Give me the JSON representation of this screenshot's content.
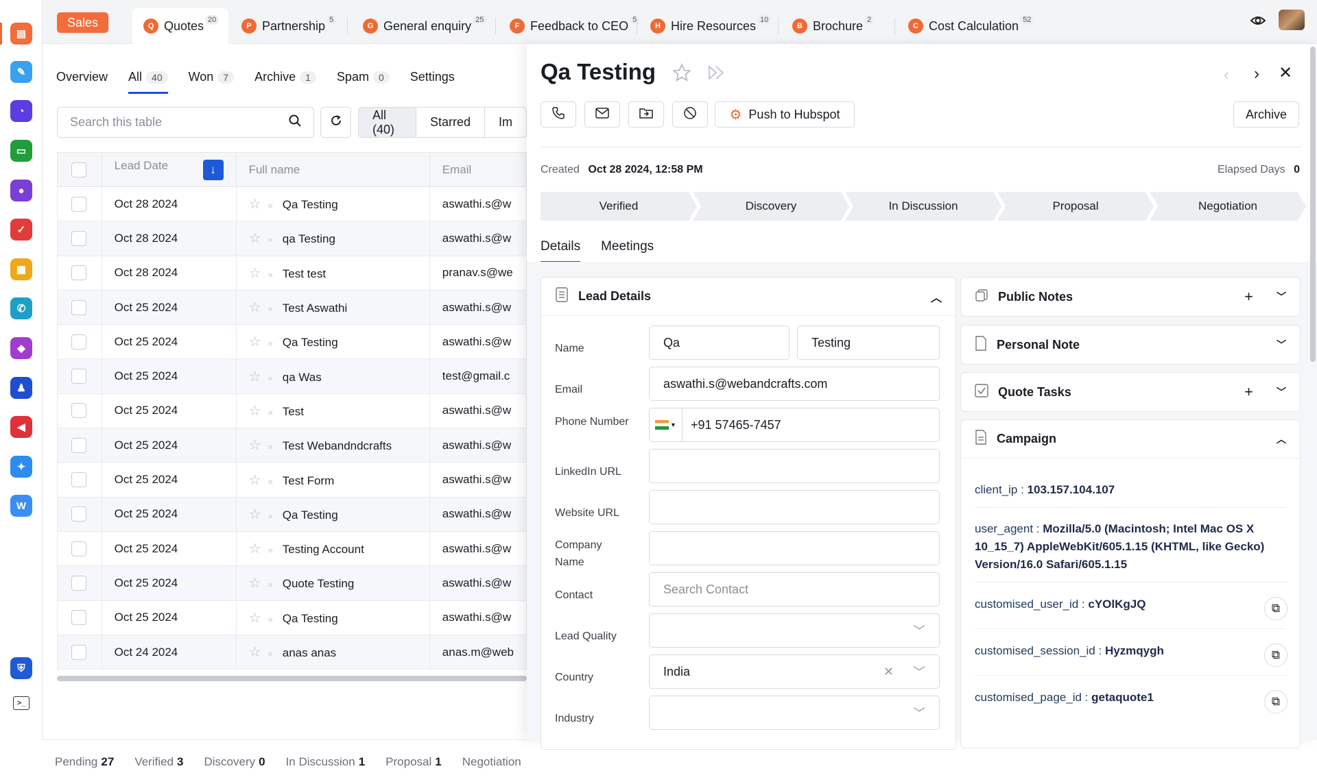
{
  "rail": {
    "icons": [
      "sales-app-icon",
      "forms-app-icon",
      "analytics-app-icon",
      "sheets-app-icon",
      "contacts-app-icon",
      "tasks-app-icon",
      "calendar-app-icon",
      "phone-app-icon",
      "products-app-icon",
      "team-app-icon",
      "campaigns-app-icon",
      "ai-app-icon",
      "w-app-icon",
      "security-app-icon",
      "terminal-app-icon"
    ]
  },
  "topbar": {
    "app_label": "Sales",
    "tabs": [
      {
        "letter": "Q",
        "label": "Quotes",
        "count": "20"
      },
      {
        "letter": "P",
        "label": "Partnership",
        "count": "5"
      },
      {
        "letter": "G",
        "label": "General enquiry",
        "count": "25"
      },
      {
        "letter": "F",
        "label": "Feedback to CEO",
        "count": "5"
      },
      {
        "letter": "H",
        "label": "Hire Resources",
        "count": "10"
      },
      {
        "letter": "B",
        "label": "Brochure",
        "count": "2"
      },
      {
        "letter": "C",
        "label": "Cost Calculation",
        "count": "52"
      }
    ]
  },
  "list": {
    "subtabs": [
      {
        "label": "Overview",
        "count": ""
      },
      {
        "label": "All",
        "count": "40"
      },
      {
        "label": "Won",
        "count": "7"
      },
      {
        "label": "Archive",
        "count": "1"
      },
      {
        "label": "Spam",
        "count": "0"
      },
      {
        "label": "Settings",
        "count": ""
      }
    ],
    "search_placeholder": "Search this table",
    "segments": [
      "All (40)",
      "Starred",
      "Im"
    ],
    "columns": [
      "Lead Date",
      "Full name",
      "Email"
    ],
    "rows": [
      {
        "date": "Oct 28 2024",
        "name": "Qa Testing",
        "email": "aswathi.s@w"
      },
      {
        "date": "Oct 28 2024",
        "name": "qa Testing",
        "email": "aswathi.s@w"
      },
      {
        "date": "Oct 28 2024",
        "name": "Test test",
        "email": "pranav.s@we"
      },
      {
        "date": "Oct 25 2024",
        "name": "Test Aswathi",
        "email": "aswathi.s@w"
      },
      {
        "date": "Oct 25 2024",
        "name": "Qa Testing",
        "email": "aswathi.s@w"
      },
      {
        "date": "Oct 25 2024",
        "name": "qa Was",
        "email": "test@gmail.c"
      },
      {
        "date": "Oct 25 2024",
        "name": "Test",
        "email": "aswathi.s@w"
      },
      {
        "date": "Oct 25 2024",
        "name": "Test Webandndcrafts",
        "email": "aswathi.s@w"
      },
      {
        "date": "Oct 25 2024",
        "name": "Test Form",
        "email": "aswathi.s@w"
      },
      {
        "date": "Oct 25 2024",
        "name": "Qa Testing",
        "email": "aswathi.s@w"
      },
      {
        "date": "Oct 25 2024",
        "name": "Testing Account",
        "email": "aswathi.s@w"
      },
      {
        "date": "Oct 25 2024",
        "name": "Quote Testing",
        "email": "aswathi.s@w"
      },
      {
        "date": "Oct 25 2024",
        "name": "Qa Testing",
        "email": "aswathi.s@w"
      },
      {
        "date": "Oct 24 2024",
        "name": "anas anas",
        "email": "anas.m@web"
      }
    ],
    "status": [
      {
        "label": "Pending",
        "count": "27"
      },
      {
        "label": "Verified",
        "count": "3"
      },
      {
        "label": "Discovery",
        "count": "0"
      },
      {
        "label": "In Discussion",
        "count": "1"
      },
      {
        "label": "Proposal",
        "count": "1"
      },
      {
        "label": "Negotiation",
        "count": ""
      }
    ]
  },
  "detail": {
    "title": "Qa Testing",
    "push_label": "Push to Hubspot",
    "archive_label": "Archive",
    "created_label": "Created",
    "created_value": "Oct 28 2024, 12:58 PM",
    "elapsed_label": "Elapsed Days",
    "elapsed_value": "0",
    "stages": [
      "Verified",
      "Discovery",
      "In Discussion",
      "Proposal",
      "Negotiation"
    ],
    "tabs": [
      "Details",
      "Meetings"
    ],
    "lead_details": {
      "heading": "Lead Details",
      "fields": [
        {
          "label": "Name"
        },
        {
          "label": "Email"
        },
        {
          "label": "Phone Number"
        },
        {
          "label": "LinkedIn URL"
        },
        {
          "label": "Website URL"
        },
        {
          "label": "Company Name"
        },
        {
          "label": "Contact"
        },
        {
          "label": "Lead Quality"
        },
        {
          "label": "Country"
        },
        {
          "label": "Industry"
        }
      ],
      "first_name": "Qa",
      "last_name": "Testing",
      "email": "aswathi.s@webandcrafts.com",
      "phone": "+91 57465-7457",
      "contact_placeholder": "Search Contact",
      "country": "India"
    },
    "side_cards": {
      "public_notes": "Public Notes",
      "personal_note": "Personal Note",
      "quote_tasks": "Quote Tasks",
      "campaign": "Campaign"
    },
    "campaign": [
      {
        "key": "client_ip",
        "value": "103.157.104.107"
      },
      {
        "key": "user_agent",
        "value": "Mozilla/5.0 (Macintosh; Intel Mac OS X 10_15_7) AppleWebKit/605.1.15 (KHTML, like Gecko) Version/16.0 Safari/605.1.15"
      },
      {
        "key": "customised_user_id",
        "value": "cYOlKgJQ"
      },
      {
        "key": "customised_session_id",
        "value": "Hyzmqygh"
      },
      {
        "key": "customised_page_id",
        "value": "getaquote1"
      }
    ]
  }
}
